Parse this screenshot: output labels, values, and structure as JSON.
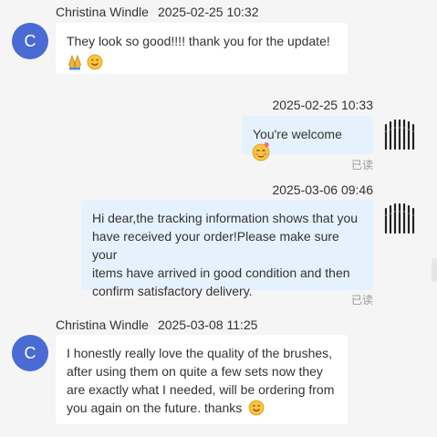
{
  "messages": [
    {
      "sender": "Christina Windle",
      "time": "2025-02-25 10:32",
      "avatar_letter": "C",
      "text": "They look so good!!!! thank you for the update!",
      "emojis": [
        "folded-hands-emoji",
        "smiling-face-emoji"
      ]
    },
    {
      "time": "2025-02-25 10:33",
      "text": "You're welcome",
      "emojis": [
        "blushing-face-emoji"
      ],
      "status": "已读"
    },
    {
      "time": "2025-03-06 09:46",
      "lines": [
        "Hi dear,the tracking information shows that you",
        "have received your order!Please make sure your",
        "items have arrived in good condition and then",
        "confirm satisfactory delivery."
      ],
      "status": "已读"
    },
    {
      "sender": "Christina Windle",
      "time": "2025-03-08 11:25",
      "avatar_letter": "C",
      "lines": [
        "I honestly really love the quality of the brushes,",
        "after using them on quite a few sets now they",
        "are exactly what I needed, will be ordering from",
        "you again on the future. thanks"
      ],
      "emojis": [
        "smiling-face-emoji"
      ]
    }
  ],
  "colors": {
    "background": "#f5f5f5",
    "avatar": "#4a6bd3",
    "outgoing_bubble": "#e5f1fd",
    "incoming_bubble": "#ffffff",
    "read_status": "#999999"
  }
}
